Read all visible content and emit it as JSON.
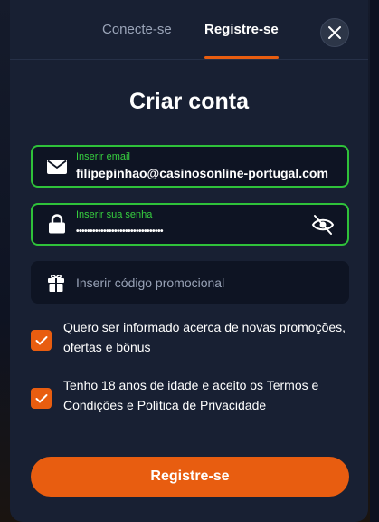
{
  "tabs": {
    "login_label": "Conecte-se",
    "register_label": "Registre-se"
  },
  "form": {
    "title": "Criar conta",
    "email": {
      "label": "Inserir email",
      "value": "filipepinhao@casinosonline-portugal.com",
      "icon": "envelope-icon"
    },
    "password": {
      "label": "Inserir sua senha",
      "value": "••••••••••••••••••••••••••••••••",
      "icon": "lock-icon",
      "toggle_icon": "eye-slash-icon"
    },
    "promo": {
      "placeholder": "Inserir código promocional",
      "icon": "gift-icon"
    },
    "consent_marketing": {
      "text": "Quero ser informado acerca de novas promoções, ofertas e bônus",
      "checked": true
    },
    "consent_terms": {
      "prefix": "Tenho 18 anos de idade e aceito os ",
      "terms_link": "Termos e Condições",
      "middle": " e ",
      "privacy_link": "Política de Privacidade",
      "checked": true
    },
    "submit_label": "Registre-se"
  },
  "colors": {
    "accent": "#e85d10",
    "valid": "#2fc23a",
    "modal_bg": "#182033"
  }
}
